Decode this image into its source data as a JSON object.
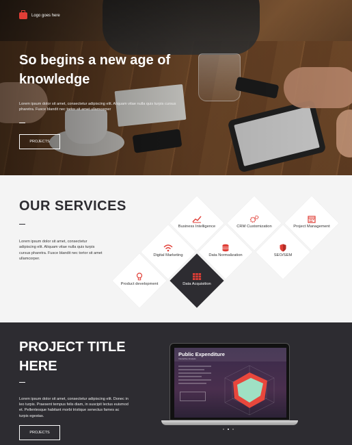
{
  "logo": {
    "text": "Logo goes here",
    "icon": "briefcase-icon"
  },
  "hero": {
    "title": "So begins a new age of knowledge",
    "body": "Lorem ipsum dolor sit amet, consectetur adipiscing elit. Aliquam vitae nulla quis turpis cursus pharetra. Fusce blandit nec tortor sit amet ullamcorper",
    "button": "PROJECTS"
  },
  "services": {
    "title": "OUR SERVICES",
    "body": "Lorem ipsum dolor sit amet, consectetur adipiscing elit. Aliquam vitae nulla quis turpis cursus pharetra. Fusce blandit nec tortor sit amet ullamcorper.",
    "items": [
      {
        "label": "Business Intelligence",
        "icon": "chart-icon"
      },
      {
        "label": "CRM Customization",
        "icon": "gears-icon"
      },
      {
        "label": "Project Management",
        "icon": "calendar-icon"
      },
      {
        "label": "Digital Marketing",
        "icon": "wifi-icon"
      },
      {
        "label": "Data Normalization",
        "icon": "database-icon"
      },
      {
        "label": "SEO/SEM",
        "icon": "shield-icon"
      },
      {
        "label": "Product development",
        "icon": "lightbulb-icon"
      },
      {
        "label": "Data Acquisition",
        "icon": "grid-icon"
      }
    ]
  },
  "project": {
    "title": "PROJECT TITLE HERE",
    "body": "Lorem ipsum dolor sit amet, consectetur adipiscing elit. Donec in leo turpis. Praesent tempus felis diam, in suscipit lectus euismod et. Pellentesque habitant morbi tristique senectus fames ac turpis egestas.",
    "button": "PROJECTS",
    "screen_title": "Public Expenditure",
    "screen_sub": "Interactive Analysis"
  },
  "colors": {
    "accent": "#e03e36",
    "dark": "#2d2c31",
    "light": "#f4f4f4"
  }
}
